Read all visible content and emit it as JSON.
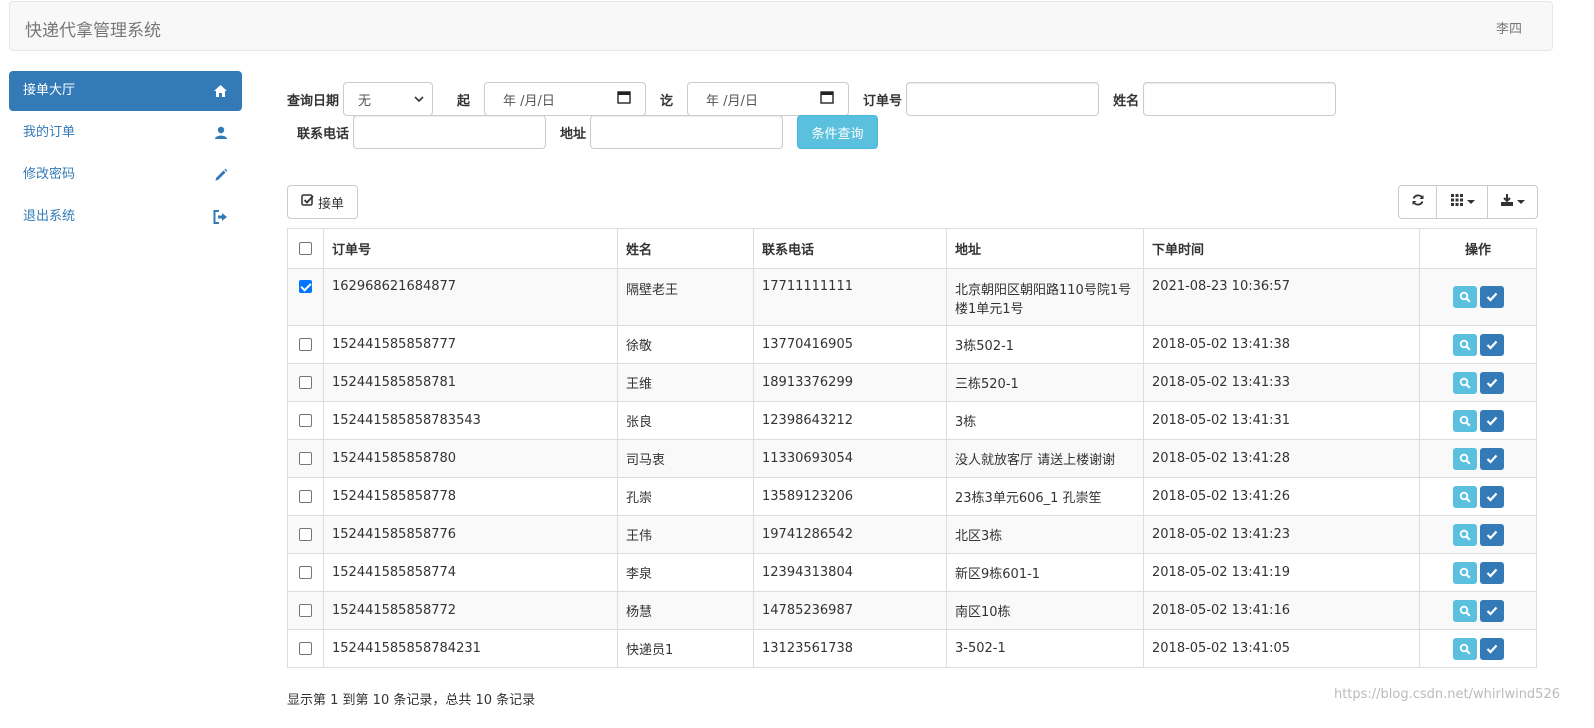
{
  "navbar": {
    "brand": "快递代拿管理系统",
    "user": "李四"
  },
  "sidebar": {
    "items": [
      {
        "label": "接单大厅",
        "icon": "home-icon",
        "active": true
      },
      {
        "label": "我的订单",
        "icon": "user-icon",
        "active": false
      },
      {
        "label": "修改密码",
        "icon": "pencil-icon",
        "active": false
      },
      {
        "label": "退出系统",
        "icon": "logout-icon",
        "active": false
      }
    ]
  },
  "search": {
    "date_label": "查询日期",
    "date_select_value": "无",
    "from_label": "起",
    "from_placeholder": "年 /月/日",
    "to_label": "讫",
    "to_placeholder": "年 /月/日",
    "order_label": "订单号",
    "name_label": "姓名",
    "phone_label": "联系电话",
    "address_label": "地址",
    "query_button": "条件查询"
  },
  "toolbar": {
    "accept_label": "接单"
  },
  "table": {
    "columns": [
      "订单号",
      "姓名",
      "联系电话",
      "地址",
      "下单时间",
      "操作"
    ],
    "rows": [
      {
        "checked": true,
        "order": "162968621684877",
        "name": "隔壁老王",
        "phone": "17711111111",
        "address": "北京朝阳区朝阳路110号院1号楼1单元1号",
        "time": "2021-08-23 10:36:57"
      },
      {
        "checked": false,
        "order": "152441585858777",
        "name": "徐敬",
        "phone": "13770416905",
        "address": "3栋502-1",
        "time": "2018-05-02 13:41:38"
      },
      {
        "checked": false,
        "order": "152441585858781",
        "name": "王维",
        "phone": "18913376299",
        "address": "三栋520-1",
        "time": "2018-05-02 13:41:33"
      },
      {
        "checked": false,
        "order": "152441585858783543",
        "name": "张良",
        "phone": "12398643212",
        "address": "3栋",
        "time": "2018-05-02 13:41:31"
      },
      {
        "checked": false,
        "order": "152441585858780",
        "name": "司马衷",
        "phone": "11330693054",
        "address": "没人就放客厅 请送上楼谢谢",
        "time": "2018-05-02 13:41:28"
      },
      {
        "checked": false,
        "order": "152441585858778",
        "name": "孔崇",
        "phone": "13589123206",
        "address": "23栋3单元606_1 孔崇笙",
        "time": "2018-05-02 13:41:26"
      },
      {
        "checked": false,
        "order": "152441585858776",
        "name": "王伟",
        "phone": "19741286542",
        "address": "北区3栋",
        "time": "2018-05-02 13:41:23"
      },
      {
        "checked": false,
        "order": "152441585858774",
        "name": "李泉",
        "phone": "12394313804",
        "address": "新区9栋601-1",
        "time": "2018-05-02 13:41:19"
      },
      {
        "checked": false,
        "order": "152441585858772",
        "name": "杨慧",
        "phone": "14785236987",
        "address": "南区10栋",
        "time": "2018-05-02 13:41:16"
      },
      {
        "checked": false,
        "order": "152441585858784231",
        "name": "快递员1",
        "phone": "13123561738",
        "address": "3-502-1",
        "time": "2018-05-02 13:41:05"
      }
    ]
  },
  "pagination": {
    "summary": "显示第 1 到第 10 条记录，总共 10 条记录"
  },
  "watermark": "https://blog.csdn.net/whirlwind526",
  "colors": {
    "primary": "#337ab7",
    "info": "#5bc0de"
  }
}
